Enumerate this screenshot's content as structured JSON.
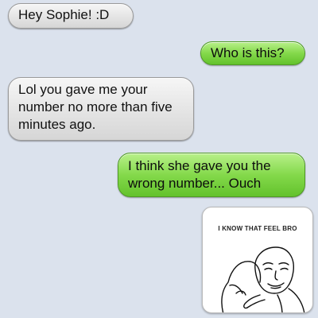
{
  "messages": [
    {
      "id": "m1",
      "sender": "them",
      "lines": [
        "Hey Sophie! :D"
      ]
    },
    {
      "id": "m2",
      "sender": "me",
      "lines": [
        "Who is this?"
      ]
    },
    {
      "id": "m3",
      "sender": "them",
      "lines": [
        "Lol you gave me your",
        "number no more than five",
        "minutes ago."
      ]
    },
    {
      "id": "m4",
      "sender": "me",
      "lines": [
        "I think she gave you the",
        "wrong number... Ouch"
      ]
    }
  ],
  "meme": {
    "caption": "I KNOW THAT FEEL BRO",
    "image": "two-people-hugging-drawing"
  },
  "colors": {
    "background": "#dbe2ed",
    "incoming_bubble": "#e4e4e4",
    "outgoing_bubble": "#84d94b"
  }
}
